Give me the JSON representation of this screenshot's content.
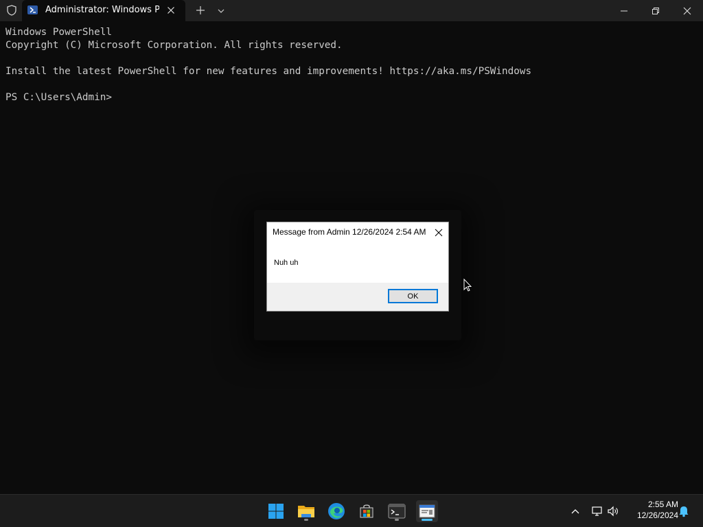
{
  "window": {
    "tab_title": "Administrator: Windows PowerShell",
    "icons": {
      "shield": "shield-icon",
      "tab": "powershell-icon",
      "tab_close": "close-icon",
      "new_tab": "plus-icon",
      "tab_dropdown": "chevron-down-icon",
      "minimize": "minimize-icon",
      "maximize": "restore-icon",
      "close": "close-icon"
    }
  },
  "console": {
    "lines": [
      "Windows PowerShell",
      "Copyright (C) Microsoft Corporation. All rights reserved.",
      "",
      "Install the latest PowerShell for new features and improvements! https://aka.ms/PSWindows",
      "",
      "PS C:\\Users\\Admin>"
    ]
  },
  "dialog": {
    "title": "Message from Admin 12/26/2024 2:54 AM",
    "message": "Nuh uh",
    "ok_label": "OK"
  },
  "taskbar": {
    "apps": [
      {
        "name": "start-button",
        "icon": "windows-logo-icon"
      },
      {
        "name": "file-explorer",
        "icon": "folder-icon"
      },
      {
        "name": "edge",
        "icon": "edge-icon"
      },
      {
        "name": "store",
        "icon": "store-icon"
      },
      {
        "name": "terminal",
        "icon": "terminal-icon"
      },
      {
        "name": "message-window",
        "icon": "message-window-icon"
      }
    ],
    "tray": [
      "chevron-up-icon",
      "network-icon",
      "volume-icon",
      "notification-bell-icon"
    ],
    "time": "2:55 AM",
    "date": "12/26/2024"
  },
  "colors": {
    "console_bg": "#0c0c0c",
    "titlebar_bg": "#202020",
    "taskbar_bg": "#1c1c1c",
    "accent": "#4cc2ff"
  }
}
